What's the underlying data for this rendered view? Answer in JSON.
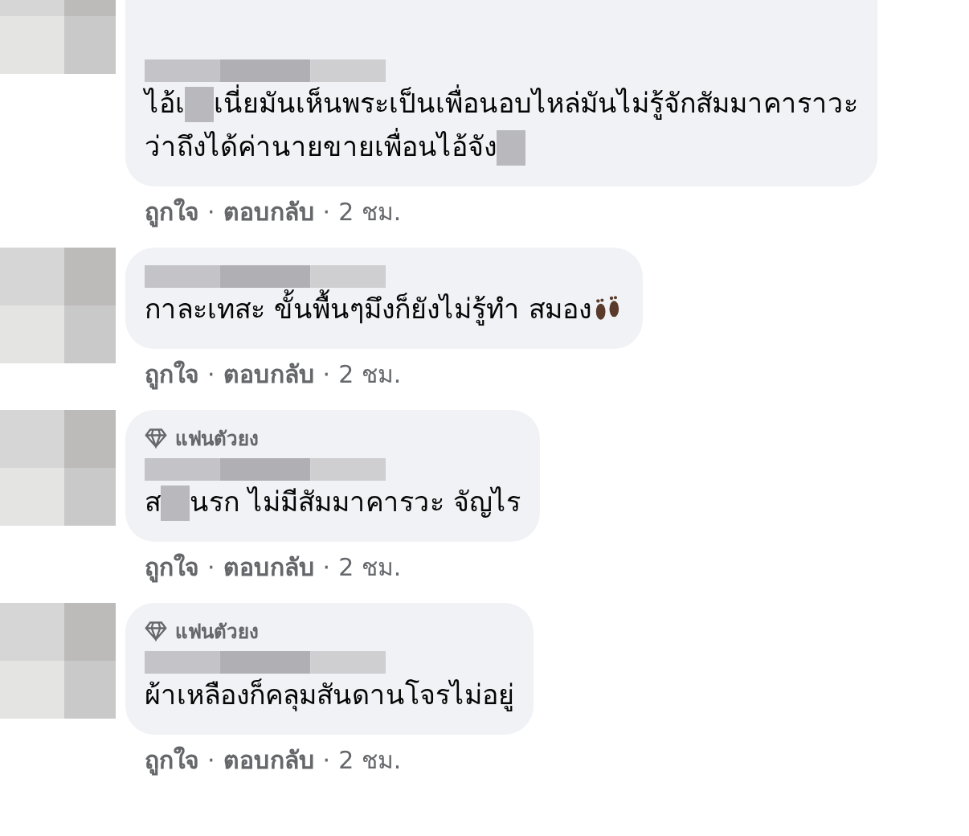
{
  "comments": [
    {
      "segments": [
        {
          "kind": "text",
          "text": "ไอ้เ"
        },
        {
          "kind": "redacted"
        },
        {
          "kind": "text",
          "text": "เนี่ยมันเห็นพระเป็นเพื่อนอบไหล่มันไม่รู้จักสัมมาคาราวะ"
        },
        {
          "kind": "break"
        },
        {
          "kind": "text",
          "text": "ว่าถึงได้ค่านายขายเพื่อนไอ้จัง"
        },
        {
          "kind": "redacted"
        }
      ],
      "actions": [
        "ถูกใจ",
        "ตอบกลับ",
        "2 ชม."
      ]
    },
    {
      "segments": [
        {
          "kind": "text",
          "text": "กาละเทสะ ขั้นพื้นๆมึงก็ยังไม่รู้ทำ สมอง"
        },
        {
          "kind": "emoji"
        }
      ],
      "actions": [
        "ถูกใจ",
        "ตอบกลับ",
        "2 ชม."
      ]
    },
    {
      "badge": "แฟนตัวยง",
      "segments": [
        {
          "kind": "text",
          "text": "ส"
        },
        {
          "kind": "redacted"
        },
        {
          "kind": "text",
          "text": "นรก ไม่มีสัมมาคารวะ จัญไร"
        }
      ],
      "actions": [
        "ถูกใจ",
        "ตอบกลับ",
        "2 ชม."
      ]
    },
    {
      "badge": "แฟนตัวยง",
      "segments": [
        {
          "kind": "text",
          "text": "ผ้าเหลืองก็คลุมสันดานโจรไม่อยู่"
        }
      ],
      "actions": [
        "ถูกใจ",
        "ตอบกลับ",
        "2 ชม."
      ]
    }
  ],
  "separator": "·"
}
